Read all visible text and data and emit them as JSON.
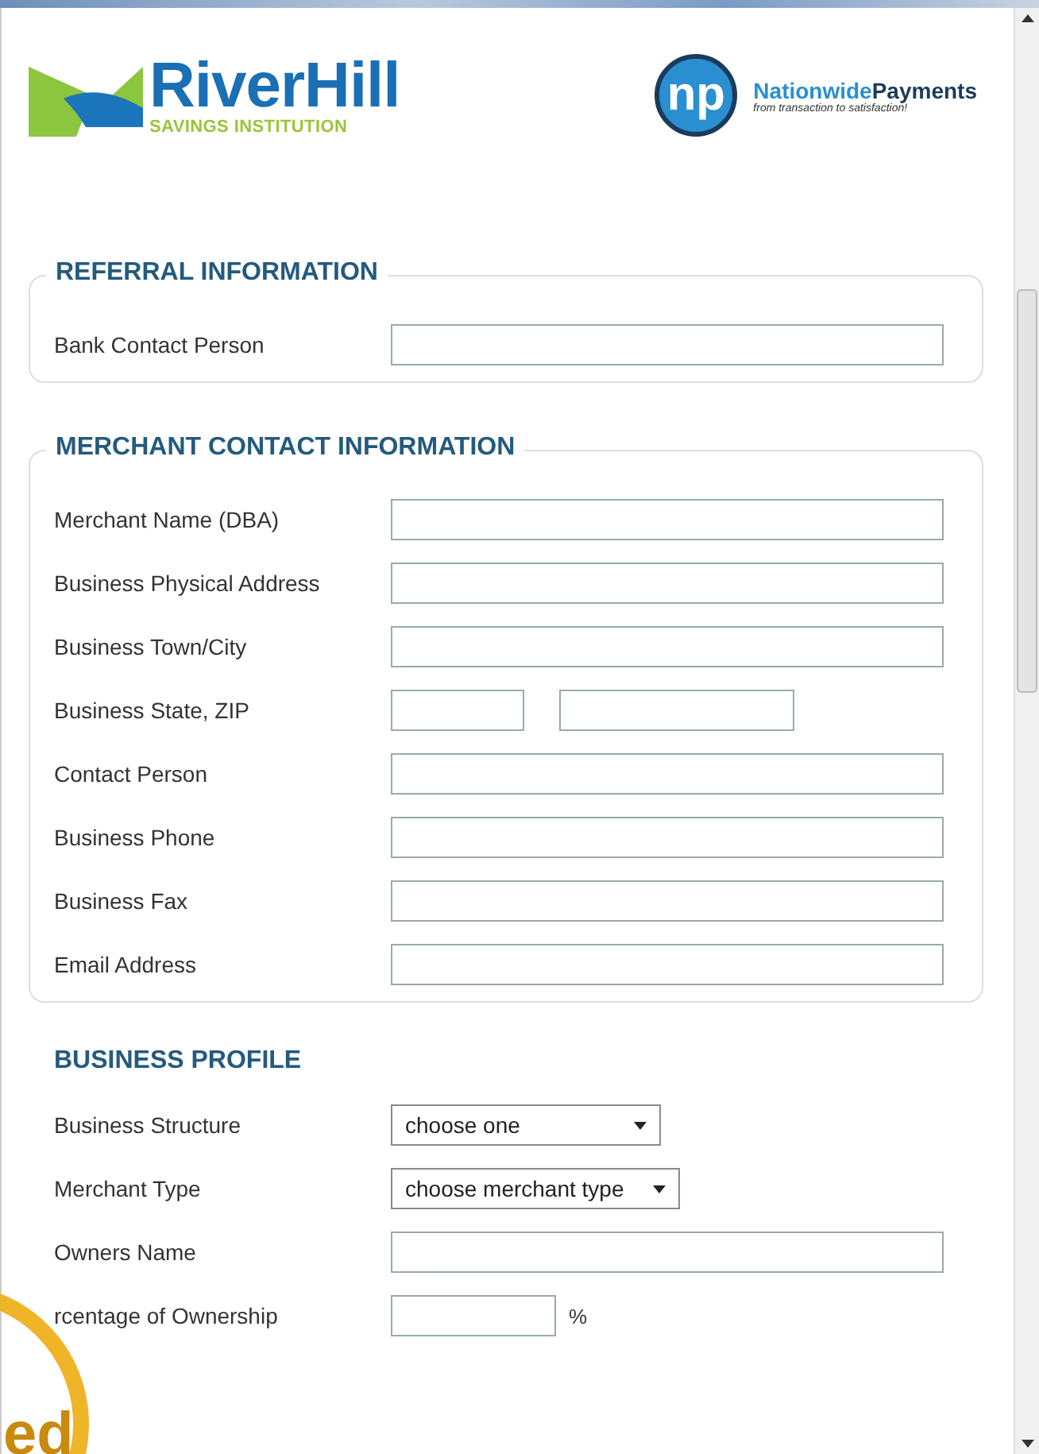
{
  "header": {
    "bank_name": "RiverHill",
    "bank_subtitle": "SAVINGS INSTITUTION",
    "partner_mark": "np",
    "partner_name_first": "Nationwide",
    "partner_name_second": "Payments",
    "partner_tagline": "from transaction to satisfaction!"
  },
  "sections": [
    {
      "title": "REFERRAL INFORMATION",
      "boxed": true,
      "fields": [
        {
          "kind": "text",
          "label": "Bank Contact Person"
        }
      ]
    },
    {
      "title": "MERCHANT CONTACT INFORMATION",
      "boxed": true,
      "fields": [
        {
          "kind": "text",
          "label": "Merchant Name (DBA)"
        },
        {
          "kind": "text",
          "label": "Business Physical Address"
        },
        {
          "kind": "text",
          "label": "Business Town/City"
        },
        {
          "kind": "pair",
          "label": "Business State, ZIP"
        },
        {
          "kind": "text",
          "label": "Contact Person"
        },
        {
          "kind": "text",
          "label": "Business Phone"
        },
        {
          "kind": "text",
          "label": "Business Fax"
        },
        {
          "kind": "text",
          "label": "Email Address"
        }
      ]
    },
    {
      "title": "BUSINESS PROFILE",
      "boxed": false,
      "fields": [
        {
          "kind": "select",
          "label": "Business Structure",
          "value": "choose one"
        },
        {
          "kind": "select",
          "label": "Merchant Type",
          "value": "choose merchant type"
        },
        {
          "kind": "text",
          "label": "Owners Name"
        },
        {
          "kind": "suffix",
          "label": "rcentage of Ownership",
          "suffix": "%"
        }
      ]
    }
  ],
  "badge": {
    "text": "ed"
  }
}
